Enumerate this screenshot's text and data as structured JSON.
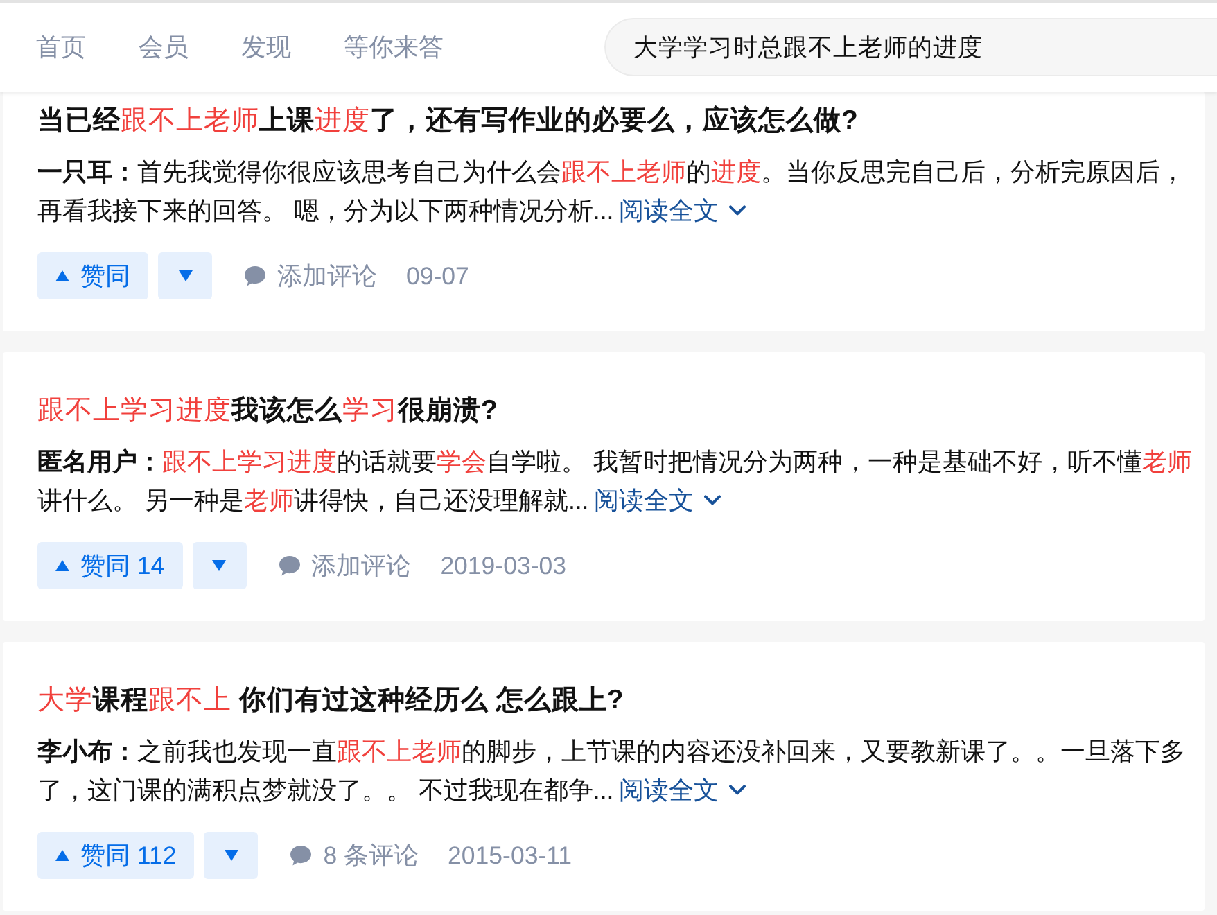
{
  "top_nav": {
    "items": [
      {
        "label": "首页"
      },
      {
        "label": "会员"
      },
      {
        "label": "发现"
      },
      {
        "label": "等你来答"
      }
    ],
    "search": {
      "value": "大学学习时总跟不上老师的进度"
    }
  },
  "results": [
    {
      "title": [
        {
          "text": "当已经",
          "highlight": false
        },
        {
          "text": "跟不上老师",
          "highlight": true
        },
        {
          "text": "上课",
          "highlight": false
        },
        {
          "text": "进度",
          "highlight": true
        },
        {
          "text": "了，还有写作业的必要么，应该怎么做?",
          "highlight": false
        }
      ],
      "author": "一只耳：",
      "excerpt": [
        {
          "text": "首先我觉得你很应该思考自己为什么会",
          "highlight": false
        },
        {
          "text": "跟不上老师",
          "highlight": true
        },
        {
          "text": "的",
          "highlight": false
        },
        {
          "text": "进度",
          "highlight": true
        },
        {
          "text": "。当你反思完自己后，分析完原因后，再看我接下来的回答。 嗯，分为以下两种情况分析...",
          "highlight": false
        }
      ],
      "read_more": "阅读全文",
      "upvote": "赞同",
      "comments": "添加评论",
      "date": "09-07"
    },
    {
      "title": [
        {
          "text": "跟不上学习进度",
          "highlight": true
        },
        {
          "text": "我该怎么",
          "highlight": false
        },
        {
          "text": "学习",
          "highlight": true
        },
        {
          "text": "很崩溃?",
          "highlight": false
        }
      ],
      "author": "匿名用户：",
      "excerpt": [
        {
          "text": "跟不上学习进度",
          "highlight": true
        },
        {
          "text": "的话就要",
          "highlight": false
        },
        {
          "text": "学会",
          "highlight": true
        },
        {
          "text": "自学啦。 我暂时把情况分为两种，一种是基础不好，听不懂",
          "highlight": false
        },
        {
          "text": "老师",
          "highlight": true
        },
        {
          "text": "讲什么。 另一种是",
          "highlight": false
        },
        {
          "text": "老师",
          "highlight": true
        },
        {
          "text": "讲得快，自己还没理解就...",
          "highlight": false
        }
      ],
      "read_more": "阅读全文",
      "upvote": "赞同 14",
      "comments": "添加评论",
      "date": "2019-03-03"
    },
    {
      "title": [
        {
          "text": "大学",
          "highlight": true
        },
        {
          "text": "课程",
          "highlight": false
        },
        {
          "text": "跟不上",
          "highlight": true
        },
        {
          "text": " 你们有过这种经历么 怎么跟上?",
          "highlight": false
        }
      ],
      "author": "李小布：",
      "excerpt": [
        {
          "text": "之前我也发现一直",
          "highlight": false
        },
        {
          "text": "跟不上老师",
          "highlight": true
        },
        {
          "text": "的脚步，上节课的内容还没补回来，又要教新课了。。一旦落下多了，这门课的满积点梦就没了。。 不过我现在都争...",
          "highlight": false
        }
      ],
      "read_more": "阅读全文",
      "upvote": "赞同 112",
      "comments": "8 条评论",
      "date": "2015-03-11"
    }
  ]
}
